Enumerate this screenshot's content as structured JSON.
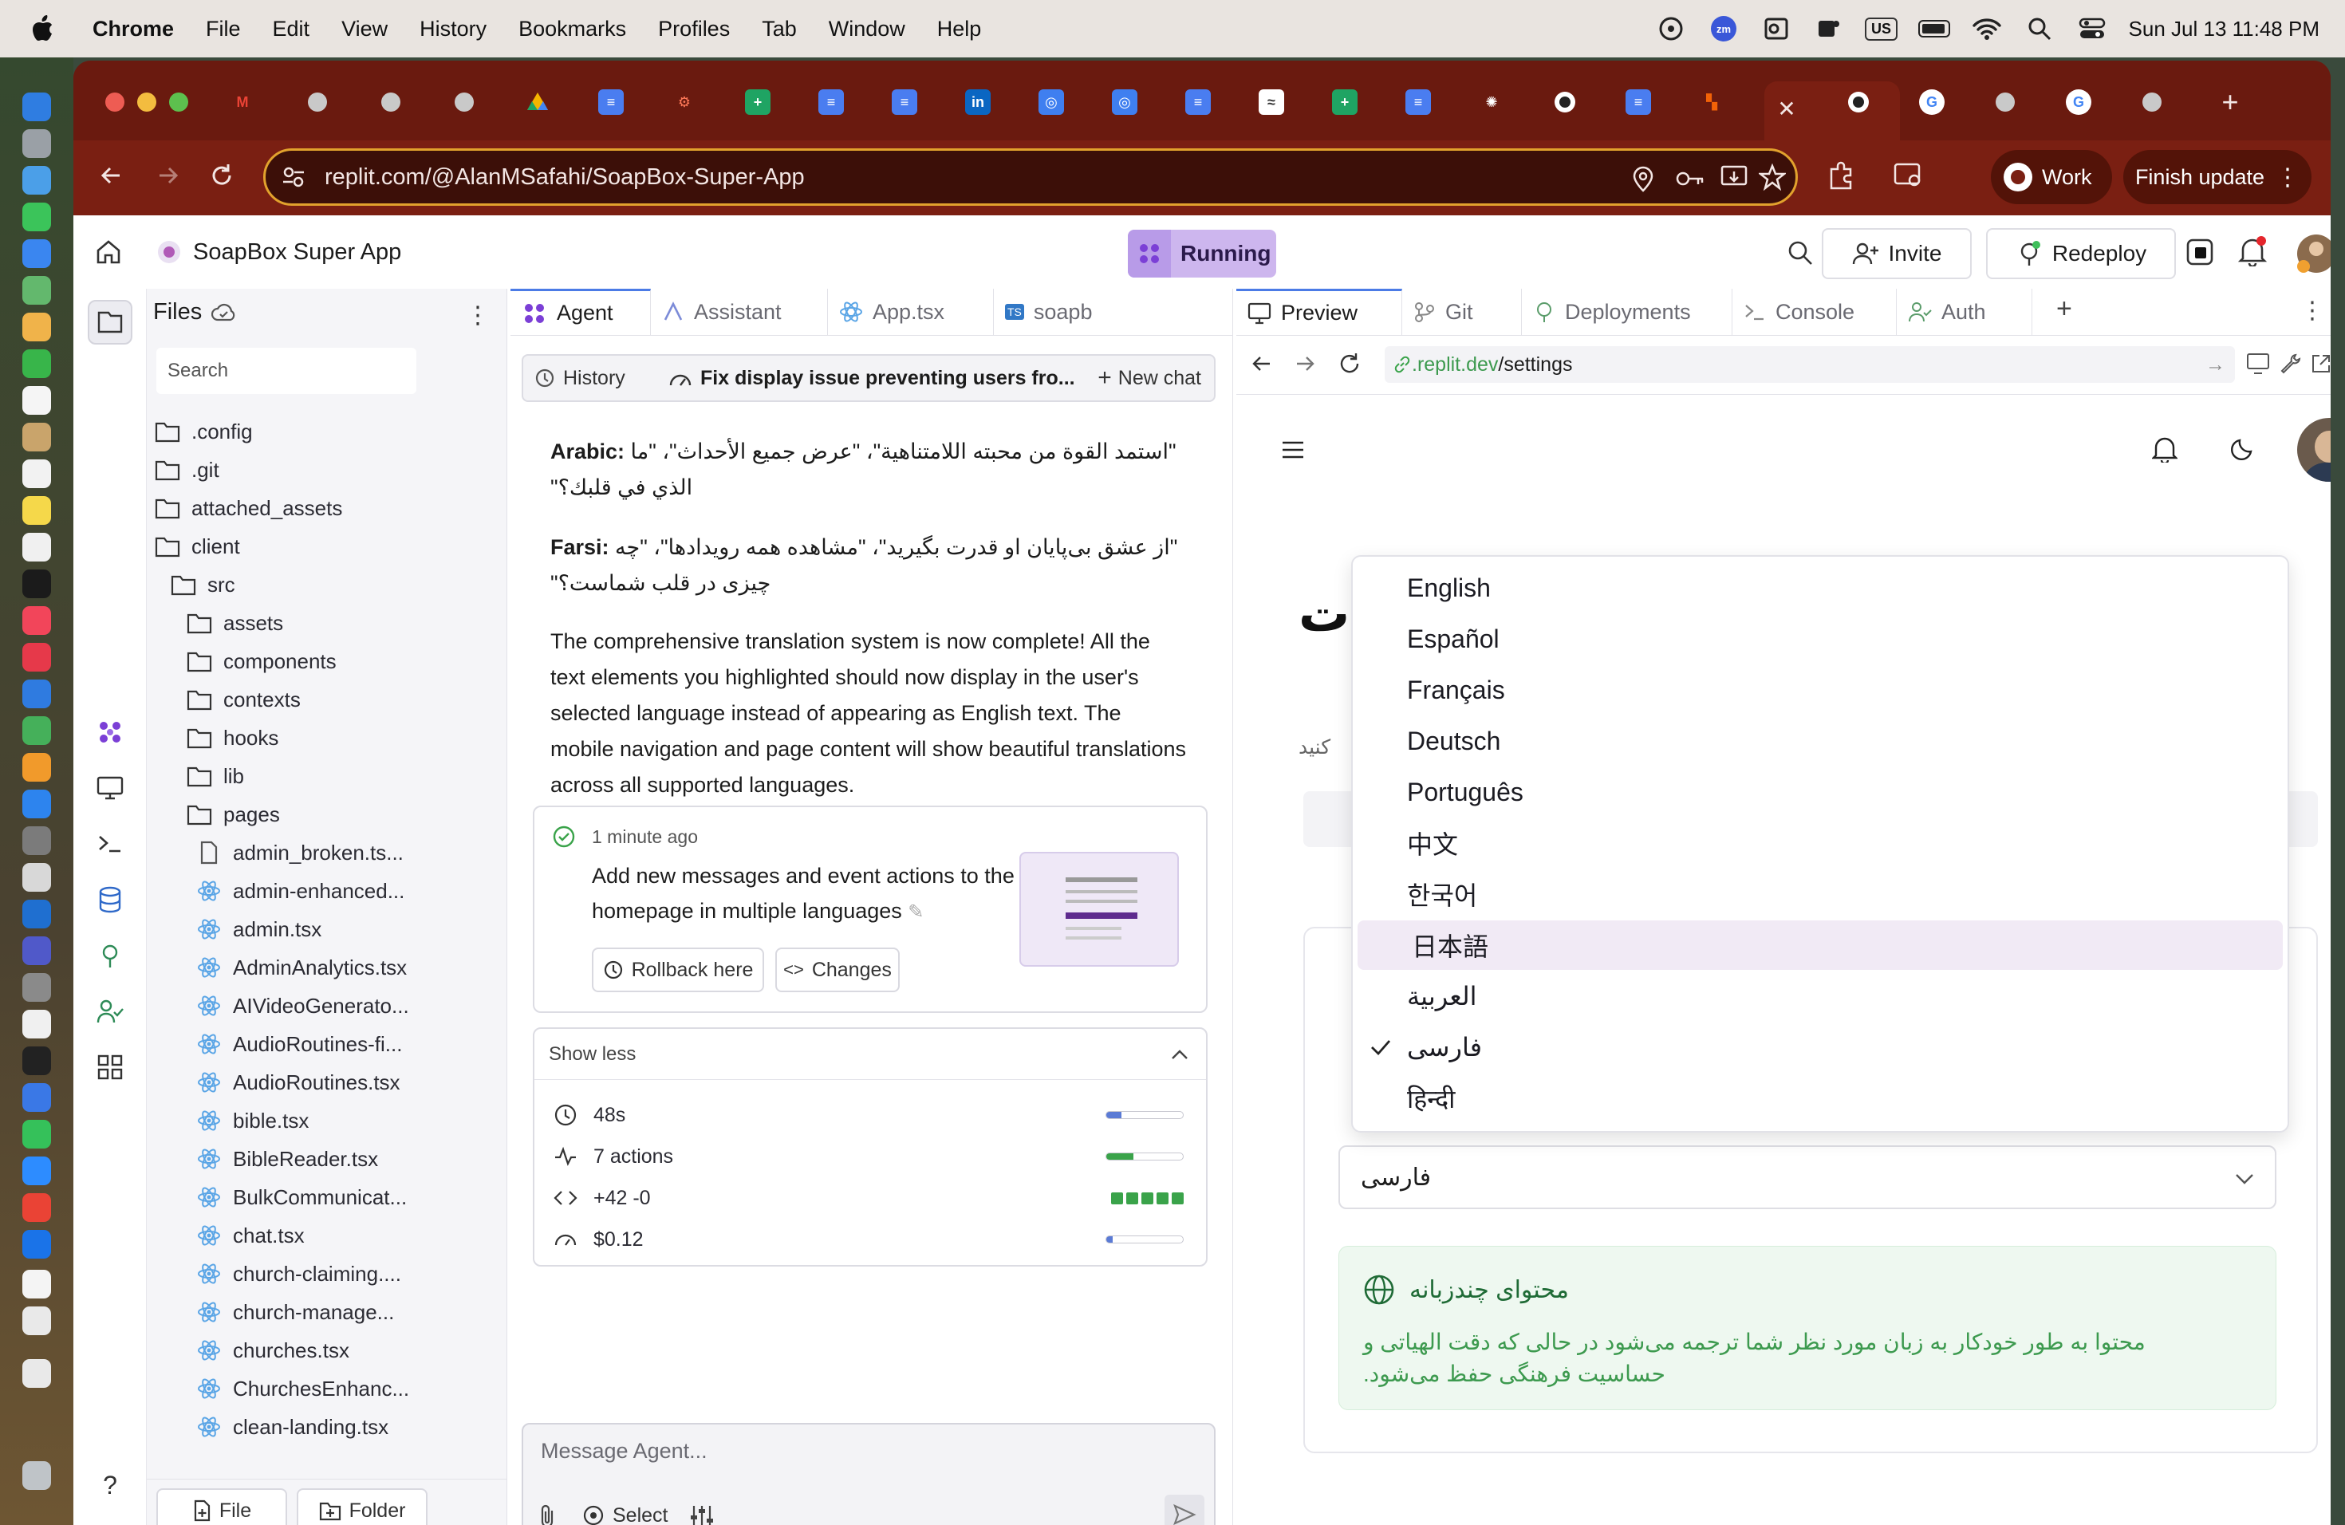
{
  "menubar": {
    "app_name": "Chrome",
    "items": [
      "File",
      "Edit",
      "View",
      "History",
      "Bookmarks",
      "Profiles",
      "Tab",
      "Window",
      "Help"
    ],
    "keyboard": "US",
    "datetime": "Sun Jul 13  11:48 PM"
  },
  "browser": {
    "url": "replit.com/@AlanMSafahi/SoapBox-Super-App",
    "profile_label": "Work",
    "finish_update_label": "Finish update"
  },
  "replit": {
    "project_name": "SoapBox Super App",
    "run_status": "Running",
    "invite_label": "Invite",
    "redeploy_label": "Redeploy"
  },
  "files": {
    "title": "Files",
    "search_placeholder": "Search",
    "tree": [
      {
        "name": ".config",
        "type": "folder",
        "depth": 0
      },
      {
        "name": ".git",
        "type": "folder",
        "depth": 0
      },
      {
        "name": "attached_assets",
        "type": "folder",
        "depth": 0
      },
      {
        "name": "client",
        "type": "folder",
        "depth": 0
      },
      {
        "name": "src",
        "type": "folder",
        "depth": 1
      },
      {
        "name": "assets",
        "type": "folder",
        "depth": 2
      },
      {
        "name": "components",
        "type": "folder",
        "depth": 2
      },
      {
        "name": "contexts",
        "type": "folder",
        "depth": 2
      },
      {
        "name": "hooks",
        "type": "folder",
        "depth": 2
      },
      {
        "name": "lib",
        "type": "folder",
        "depth": 2
      },
      {
        "name": "pages",
        "type": "folder",
        "depth": 2
      },
      {
        "name": "admin_broken.ts...",
        "type": "file",
        "depth": 3
      },
      {
        "name": "admin-enhanced...",
        "type": "react",
        "depth": 3
      },
      {
        "name": "admin.tsx",
        "type": "react",
        "depth": 3
      },
      {
        "name": "AdminAnalytics.tsx",
        "type": "react",
        "depth": 3
      },
      {
        "name": "AIVideoGenerato...",
        "type": "react",
        "depth": 3
      },
      {
        "name": "AudioRoutines-fi...",
        "type": "react",
        "depth": 3
      },
      {
        "name": "AudioRoutines.tsx",
        "type": "react",
        "depth": 3
      },
      {
        "name": "bible.tsx",
        "type": "react",
        "depth": 3
      },
      {
        "name": "BibleReader.tsx",
        "type": "react",
        "depth": 3
      },
      {
        "name": "BulkCommunicat...",
        "type": "react",
        "depth": 3
      },
      {
        "name": "chat.tsx",
        "type": "react",
        "depth": 3
      },
      {
        "name": "church-claiming....",
        "type": "react",
        "depth": 3
      },
      {
        "name": "church-manage...",
        "type": "react",
        "depth": 3
      },
      {
        "name": "churches.tsx",
        "type": "react",
        "depth": 3
      },
      {
        "name": "ChurchesEnhanc...",
        "type": "react",
        "depth": 3
      },
      {
        "name": "clean-landing.tsx",
        "type": "react",
        "depth": 3
      }
    ],
    "new_file_label": "File",
    "new_folder_label": "Folder"
  },
  "agent_tabs": [
    "Agent",
    "Assistant",
    "App.tsx",
    "soapb"
  ],
  "agent": {
    "history_label": "History",
    "chat_title": "Fix display issue preventing users fro...",
    "new_chat_label": "New chat",
    "arabic_label": "Arabic:",
    "arabic_text": "\"استمد القوة من محبته اللامتناهية\"، \"عرض جميع الأحداث\"، \"ما الذي في قلبك؟\"",
    "farsi_label": "Farsi:",
    "farsi_text": "\"از عشق بی‌پایان او قدرت بگیرید\"، \"مشاهده همه رویدادها\"، \"چه چیزی در قلب شماست؟\"",
    "summary": "The comprehensive translation system is now complete! All the text elements you highlighted should now display in the user's selected language instead of appearing as English text. The mobile navigation and page content will show beautiful translations across all supported languages.",
    "checkpoint_time": "1 minute ago",
    "checkpoint_text": "Add new messages and event actions to the homepage in multiple languages",
    "rollback_label": "Rollback here",
    "changes_label": "Changes",
    "show_less_label": "Show less",
    "stats": [
      {
        "icon": "clock-icon",
        "label": "48s",
        "fill": 0.2,
        "color": "#5b7bd5"
      },
      {
        "icon": "activity-icon",
        "label": "7 actions",
        "fill": 0.35,
        "color": "#3aa34a"
      },
      {
        "icon": "code-icon",
        "label": "+42 -0",
        "fill": 1.0,
        "color": "#3aa34a"
      },
      {
        "icon": "gauge-icon",
        "label": "$0.12",
        "fill": 0.08,
        "color": "#5b7bd5"
      }
    ],
    "message_placeholder": "Message Agent...",
    "select_label": "Select"
  },
  "preview_tabs": [
    "Preview",
    "Git",
    "Deployments",
    "Console",
    "Auth"
  ],
  "preview": {
    "url_domain": ".replit.dev",
    "url_path": "/settings",
    "heading_fragment": "ت",
    "subtitle_fragment": "کنید",
    "languages": [
      {
        "label": "English",
        "selected": false,
        "highlighted": false
      },
      {
        "label": "Español",
        "selected": false,
        "highlighted": false
      },
      {
        "label": "Français",
        "selected": false,
        "highlighted": false
      },
      {
        "label": "Deutsch",
        "selected": false,
        "highlighted": false
      },
      {
        "label": "Português",
        "selected": false,
        "highlighted": false
      },
      {
        "label": "中文",
        "selected": false,
        "highlighted": false
      },
      {
        "label": "한국어",
        "selected": false,
        "highlighted": false
      },
      {
        "label": "日本語",
        "selected": false,
        "highlighted": true
      },
      {
        "label": "العربية",
        "selected": false,
        "highlighted": false
      },
      {
        "label": "فارسی",
        "selected": true,
        "highlighted": false
      },
      {
        "label": "हिन्दी",
        "selected": false,
        "highlighted": false
      }
    ],
    "select_value": "فارسی",
    "info_title": "محتوای چندزبانه",
    "info_text": "محتوا به طور خودکار به زبان مورد نظر شما ترجمه می‌شود در حالی که دقت الهیاتی و حساسیت فرهنگی حفظ می‌شود.",
    "accent_green": "#3d9a4f",
    "highlight_bg": "#f1eaf5"
  }
}
